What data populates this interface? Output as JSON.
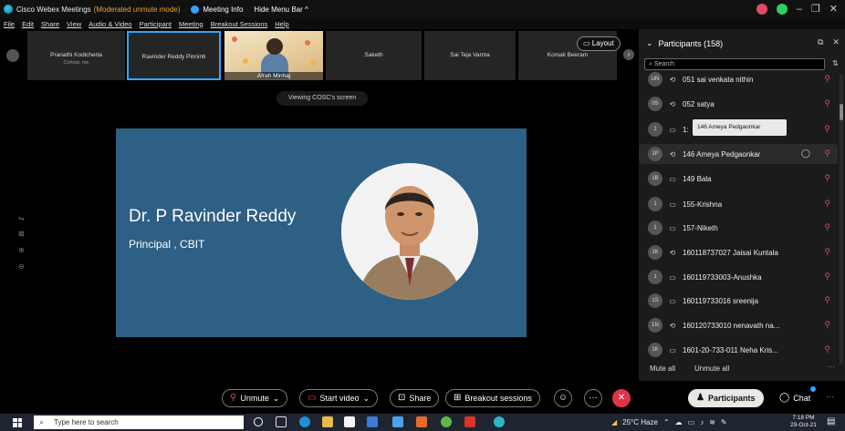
{
  "titlebar": {
    "app_title": "Cisco Webex Meetings",
    "mode": "(Moderated unmute mode)",
    "meeting_info": "Meeting Info",
    "hide_menu": "Hide Menu Bar ^",
    "window_min": "–",
    "window_max": "❐",
    "window_close": "✕"
  },
  "menubar": {
    "items": [
      "File",
      "Edit",
      "Share",
      "View",
      "Audio & Video",
      "Participant",
      "Meeting",
      "Breakout Sessions",
      "Help"
    ]
  },
  "filmstrip": {
    "tiles": [
      {
        "name": "Pranathi Kodicherla",
        "sub": "Cohost, me"
      },
      {
        "name": "Ravinder Reddy Pinninti",
        "sub": ""
      },
      {
        "name": "Afrah Minhaj",
        "sub": ""
      },
      {
        "name": "Saketh",
        "sub": ""
      },
      {
        "name": "Sai Teja Varma",
        "sub": ""
      },
      {
        "name": "Komali Beeram",
        "sub": ""
      }
    ],
    "layout_label": "Layout",
    "next_label": "›"
  },
  "viewing_label": "Viewing COSC's screen",
  "slide": {
    "name": "Dr. P Ravinder Reddy",
    "role": "Principal , CBIT"
  },
  "panel": {
    "title": "Participants (158)",
    "search_placeholder": "Search",
    "tooltip": "146 Ameya Pedgaonkar",
    "participants": [
      {
        "initials": "UN",
        "device": "⟲",
        "name": "051 sai venkata nithin"
      },
      {
        "initials": "0S",
        "device": "⟲",
        "name": "052 satya"
      },
      {
        "initials": "1",
        "device": "▭",
        "name": "1:"
      },
      {
        "initials": "1P",
        "device": "⟲",
        "name": "146 Ameya Pedgaonkar"
      },
      {
        "initials": "1B",
        "device": "▭",
        "name": "149 Bala"
      },
      {
        "initials": "1",
        "device": "▭",
        "name": "155-Krishna"
      },
      {
        "initials": "1",
        "device": "▭",
        "name": "157-Niketh"
      },
      {
        "initials": "1K",
        "device": "⟲",
        "name": "160118737027 Jaisai Kuntala"
      },
      {
        "initials": "1",
        "device": "▭",
        "name": "160119733003-Anushka"
      },
      {
        "initials": "1S",
        "device": "▭",
        "name": "160119733016 sreenija"
      },
      {
        "initials": "1N",
        "device": "⟲",
        "name": "160120733010 nenavath na..."
      },
      {
        "initials": "1K",
        "device": "▭",
        "name": "1601-20-733-011 Neha Kris..."
      }
    ],
    "mute_all": "Mute all",
    "unmute_all": "Unmute all",
    "more": "···"
  },
  "controls": {
    "unmute": "Unmute",
    "start_video": "Start video",
    "share": "Share",
    "breakout": "Breakout sessions",
    "participants": "Participants",
    "chat": "Chat",
    "more": "···"
  },
  "taskbar": {
    "search_placeholder": "Type here to search",
    "weather": "25°C Haze",
    "time": "7:18 PM",
    "date": "29-Oct-21"
  },
  "colors": {
    "accent": "#2ea8ff",
    "slide_bg": "#2e5f84",
    "end_red": "#e0334a",
    "mode_orange": "#f0a030"
  }
}
